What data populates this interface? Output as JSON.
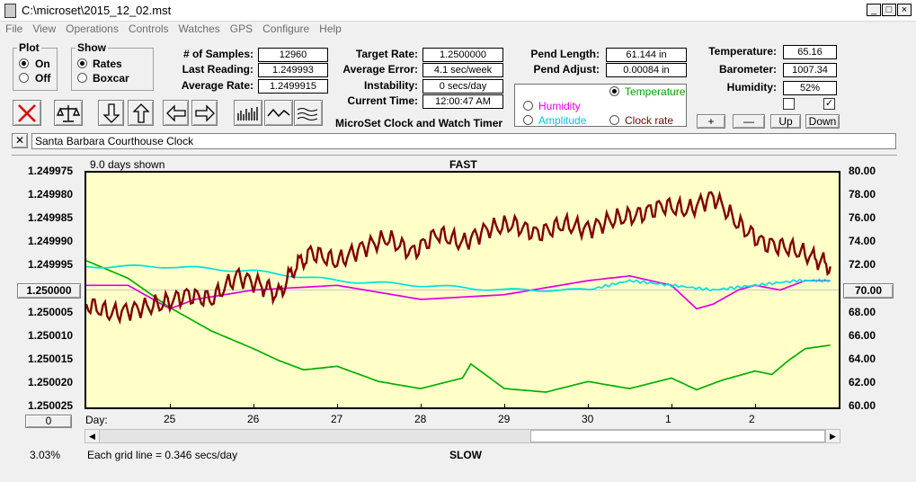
{
  "window": {
    "title": "C:\\microset\\2015_12_02.mst",
    "min": "_",
    "max": "□",
    "close": "×"
  },
  "menu": [
    "File",
    "View",
    "Operations",
    "Controls",
    "Watches",
    "GPS",
    "Configure",
    "Help"
  ],
  "plot_group": {
    "title": "Plot",
    "on": "On",
    "off": "Off"
  },
  "show_group": {
    "title": "Show",
    "rates": "Rates",
    "boxcar": "Boxcar"
  },
  "stats": {
    "samples_label": "# of Samples:",
    "samples": "12960",
    "last_label": "Last Reading:",
    "last": "1.249993",
    "avg_label": "Average Rate:",
    "avg": "1.2499915",
    "target_label": "Target Rate:",
    "target": "1.2500000",
    "avgerr_label": "Average Error:",
    "avgerr": "4.1 sec/week",
    "instab_label": "Instability:",
    "instab": "0 secs/day",
    "time_label": "Current Time:",
    "time": "12:00:47 AM",
    "pendlen_label": "Pend Length:",
    "pendlen": "61.144 in",
    "pendadj_label": "Pend Adjust:",
    "pendadj": "0.00084 in",
    "temp_label": "Temperature:",
    "temp": "65.16",
    "baro_label": "Barometer:",
    "baro": "1007.34",
    "hum_label": "Humidity:",
    "hum": "52%"
  },
  "app_name": "MicroSet Clock and Watch Timer",
  "series_select": {
    "temperature": "Temperature",
    "humidity": "Humidity",
    "amplitude": "Amplitude",
    "clockrate": "Clock rate"
  },
  "adjust_buttons": {
    "plus": "+",
    "minus": "—",
    "up": "Up",
    "down": "Down"
  },
  "description_close": "✕",
  "description": "Santa Barbara Courthouse Clock",
  "chart_header": {
    "days_shown": "9.0 days shown",
    "fast": "FAST",
    "slow": "SLOW",
    "grid_note": "Each grid line = 0.346 secs/day",
    "percent": "3.03%",
    "day_label": "Day:",
    "left_button": "1.250000",
    "right_button": "70.00",
    "bottom_button": "0"
  },
  "colors": {
    "clockrate": "#800000",
    "temperature": "#00b000",
    "humidity": "#e000e0",
    "amplitude": "#00e0e0",
    "plot_bg": "#ffffc8"
  },
  "chart_data": {
    "type": "line",
    "y_left_ticks": [
      "1.249975",
      "1.249980",
      "1.249985",
      "1.249990",
      "1.249995",
      "1.250000",
      "1.250005",
      "1.250010",
      "1.250015",
      "1.250020",
      "1.250025"
    ],
    "y_right_ticks": [
      "80.00",
      "78.00",
      "76.00",
      "74.00",
      "72.00",
      "70.00",
      "68.00",
      "66.00",
      "64.00",
      "62.00",
      "60.00"
    ],
    "x_ticks": [
      "25",
      "26",
      "27",
      "28",
      "29",
      "30",
      "1",
      "2"
    ],
    "x_range": [
      0,
      9
    ],
    "y_left_range": [
      1.249975,
      1.250025
    ],
    "y_right_range": [
      60,
      80
    ],
    "series": [
      {
        "name": "Clock rate",
        "axis": "left",
        "x": [
          0,
          0.3,
          0.6,
          0.9,
          1.2,
          1.5,
          1.8,
          2.1,
          2.3,
          2.5,
          2.7,
          3.0,
          3.3,
          3.6,
          3.9,
          4.2,
          4.5,
          4.8,
          5.1,
          5.4,
          5.7,
          6.0,
          6.3,
          6.6,
          6.9,
          7.2,
          7.5,
          7.8,
          8.1,
          8.4,
          8.7,
          8.9
        ],
        "y": [
          1.250003,
          1.250005,
          1.250004,
          1.250003,
          1.250001,
          1.250002,
          1.249997,
          1.249999,
          1.250001,
          1.249995,
          1.249992,
          1.249994,
          1.249991,
          1.249989,
          1.249992,
          1.249988,
          1.24999,
          1.249987,
          1.249986,
          1.249988,
          1.249986,
          1.249987,
          1.249985,
          1.249984,
          1.249982,
          1.249983,
          1.24998,
          1.249986,
          1.24999,
          1.249991,
          1.249993,
          1.249995
        ]
      },
      {
        "name": "Temperature",
        "axis": "right",
        "x": [
          0,
          0.5,
          1.0,
          1.5,
          2.0,
          2.3,
          2.6,
          3.0,
          3.5,
          4.0,
          4.5,
          4.6,
          5.0,
          5.5,
          6.0,
          6.5,
          7.0,
          7.3,
          7.6,
          8.0,
          8.2,
          8.4,
          8.6,
          8.9
        ],
        "y": [
          72.5,
          71.0,
          68.5,
          66.5,
          65.0,
          64.0,
          63.2,
          63.5,
          62.2,
          61.6,
          62.5,
          63.7,
          61.6,
          61.3,
          62.2,
          61.6,
          62.5,
          61.5,
          62.3,
          63.1,
          62.8,
          64.0,
          65.0,
          65.3
        ]
      },
      {
        "name": "Humidity",
        "axis": "left",
        "x": [
          0,
          0.5,
          1.0,
          1.3,
          2.0,
          3.0,
          4.0,
          5.0,
          6.0,
          6.5,
          7.0,
          7.3,
          7.5,
          7.8,
          8.0,
          8.3,
          8.6,
          8.9
        ],
        "y": [
          1.249999,
          1.249999,
          1.250004,
          1.250002,
          1.25,
          1.249999,
          1.250002,
          1.250001,
          1.249998,
          1.249997,
          1.249999,
          1.250004,
          1.250003,
          1.25,
          1.249999,
          1.25,
          1.249998,
          1.249998
        ]
      },
      {
        "name": "Amplitude",
        "axis": "left",
        "x": [
          0,
          1.0,
          2.0,
          3.0,
          4.0,
          5.0,
          6.0,
          6.5,
          7.0,
          7.5,
          8.0,
          8.5,
          8.9
        ],
        "y": [
          1.249995,
          1.249995,
          1.249996,
          1.249998,
          1.249999,
          1.25,
          1.25,
          1.249998,
          1.249999,
          1.25,
          1.249999,
          1.249998,
          1.249998
        ]
      }
    ],
    "grid": false
  }
}
